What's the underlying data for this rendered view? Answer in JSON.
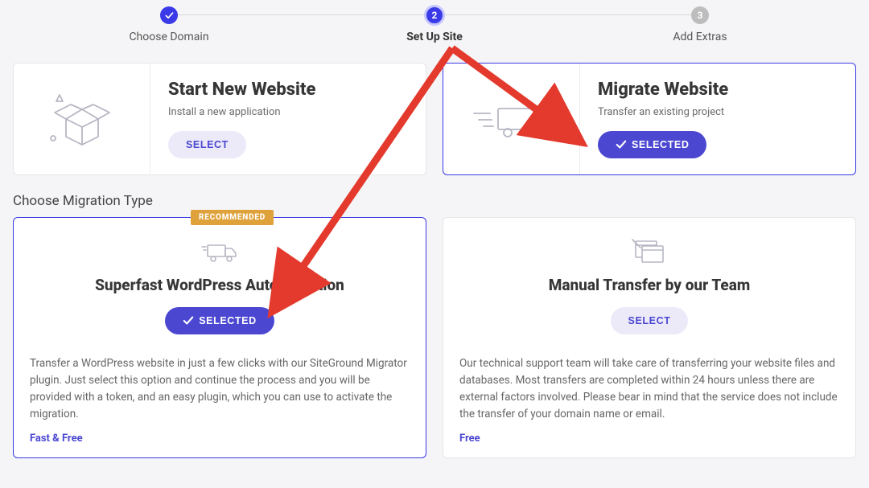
{
  "stepper": {
    "steps": [
      {
        "num": "✓",
        "label": "Choose Domain",
        "state": "done"
      },
      {
        "num": "2",
        "label": "Set Up Site",
        "state": "active"
      },
      {
        "num": "3",
        "label": "Add Extras",
        "state": "upcoming"
      }
    ]
  },
  "options": {
    "start": {
      "title": "Start New Website",
      "sub": "Install a new application",
      "button": "SELECT"
    },
    "migrate": {
      "title": "Migrate Website",
      "sub": "Transfer an existing project",
      "button": "SELECTED"
    }
  },
  "section_title": "Choose Migration Type",
  "mig": {
    "auto": {
      "badge": "RECOMMENDED",
      "title": "Superfast WordPress Automigration",
      "button": "SELECTED",
      "desc": "Transfer a WordPress website in just a few clicks with our SiteGround Migrator plugin. Just select this option and continue the process and you will be provided with a token, and an easy plugin, which you can use to activate the migration.",
      "footer": "Fast & Free"
    },
    "manual": {
      "title": "Manual Transfer by our Team",
      "button": "SELECT",
      "desc": "Our technical support team will take care of transferring your website files and databases. Most transfers are completed within 24 hours unless there are external factors involved. Please bear in mind that the service does not include the transfer of your domain name or email.",
      "footer": "Free"
    }
  }
}
